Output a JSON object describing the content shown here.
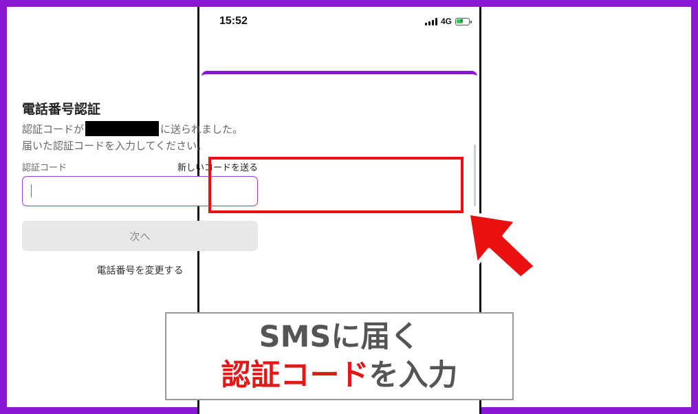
{
  "status_bar": {
    "time": "15:52",
    "network": "4G",
    "battery_level": 0.6,
    "battery_color": "#35c759",
    "icons": [
      "signal-icon",
      "battery-charging-icon"
    ]
  },
  "dialog": {
    "title": "電話番号認証",
    "message_prefix": "認証コードが",
    "message_suffix": "に送られました。",
    "message_line2": "届いた認証コードを入力してください。",
    "code_label": "認証コード",
    "resend_link": "新しいコードを送る",
    "code_input_value": "",
    "next_button": "次へ",
    "change_number_link": "電話番号を変更する"
  },
  "caption": {
    "line1": "SMSに届く",
    "line2_red": "認証コード",
    "line2_rest": "を入力"
  },
  "colors": {
    "frame": "#8a17d6",
    "accent": "#8a17d6",
    "highlight": "#e81010",
    "caption_red": "#e01818",
    "caption_gray": "#555555"
  }
}
